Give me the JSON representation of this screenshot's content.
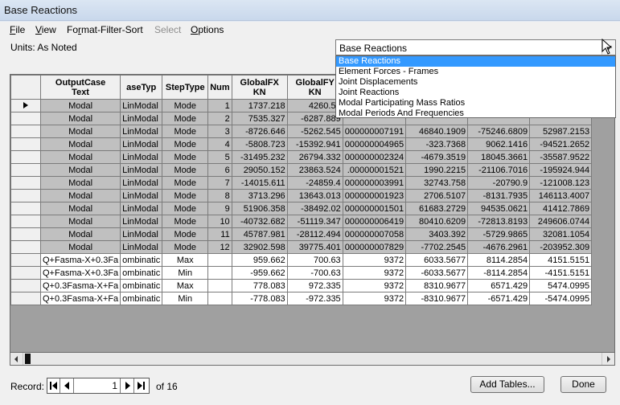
{
  "window": {
    "title": "Base Reactions"
  },
  "menu": [
    {
      "id": "file",
      "label": "File",
      "accel": "F",
      "rest": "ile"
    },
    {
      "id": "view",
      "label": "View",
      "accel": "V",
      "rest": "iew"
    },
    {
      "id": "format",
      "label": "Format-Filter-Sort",
      "pre": "Fo",
      "accel": "r",
      "rest": "mat-Filter-Sort"
    },
    {
      "id": "select",
      "label": "Select",
      "disabled": true
    },
    {
      "id": "options",
      "label": "Options",
      "accel": "O",
      "rest": "ptions"
    }
  ],
  "units_label": "Units:  As Noted",
  "table_selector": {
    "value": "Base Reactions",
    "options": [
      "Base Reactions",
      "Element Forces - Frames",
      "Joint Displacements",
      "Joint Reactions",
      "Modal Participating Mass Ratios",
      "Modal Periods And Frequencies"
    ],
    "selected_index": 0
  },
  "grid": {
    "columns": [
      {
        "id": "outputcase",
        "line1": "OutputCase",
        "line2": "Text"
      },
      {
        "id": "casetype",
        "line1": "aseTyp",
        "line2": ""
      },
      {
        "id": "steptype",
        "line1": "StepType",
        "line2": ""
      },
      {
        "id": "stepnum",
        "line1": "Num",
        "line2": ""
      },
      {
        "id": "globalfx",
        "line1": "GlobalFX",
        "line2": "KN"
      },
      {
        "id": "globalfy",
        "line1": "GlobalFY",
        "line2": "KN"
      },
      {
        "id": "globalfz",
        "line1": "",
        "line2": ""
      },
      {
        "id": "globalmx",
        "line1": "",
        "line2": ""
      },
      {
        "id": "globalmy",
        "line1": "",
        "line2": ""
      },
      {
        "id": "globalmz",
        "line1": "",
        "line2": ""
      }
    ],
    "rows": [
      {
        "current": true,
        "cells": [
          "Modal",
          "LinModal",
          "Mode",
          "1",
          "1737.218",
          "4260.57",
          "",
          "",
          "",
          ""
        ]
      },
      {
        "cells": [
          "Modal",
          "LinModal",
          "Mode",
          "2",
          "7535.327",
          "-6287.889",
          "",
          "",
          "",
          ""
        ]
      },
      {
        "cells": [
          "Modal",
          "LinModal",
          "Mode",
          "3",
          "-8726.646",
          "-5262.545",
          "000000007191",
          "46840.1909",
          "-75246.6809",
          "52987.2153"
        ]
      },
      {
        "cells": [
          "Modal",
          "LinModal",
          "Mode",
          "4",
          "-5808.723",
          "-15392.941",
          "000000004965",
          "-323.7368",
          "9062.1416",
          "-94521.2652"
        ]
      },
      {
        "cells": [
          "Modal",
          "LinModal",
          "Mode",
          "5",
          "-31495.232",
          "26794.332",
          "000000002324",
          "-4679.3519",
          "18045.3661",
          "-35587.9522"
        ]
      },
      {
        "cells": [
          "Modal",
          "LinModal",
          "Mode",
          "6",
          "29050.152",
          "23863.524",
          ".00000001521",
          "1990.2215",
          "-21106.7016",
          "-195924.944"
        ]
      },
      {
        "cells": [
          "Modal",
          "LinModal",
          "Mode",
          "7",
          "-14015.611",
          "-24859.4",
          "000000003991",
          "32743.758",
          "-20790.9",
          "-121008.123"
        ]
      },
      {
        "cells": [
          "Modal",
          "LinModal",
          "Mode",
          "8",
          "3713.296",
          "13643.013",
          "000000001923",
          "2706.5107",
          "-8131.7935",
          "146113.4007"
        ]
      },
      {
        "cells": [
          "Modal",
          "LinModal",
          "Mode",
          "9",
          "51906.358",
          "-38492.02",
          "000000001501",
          "61683.2729",
          "94535.0621",
          "41412.7869"
        ]
      },
      {
        "cells": [
          "Modal",
          "LinModal",
          "Mode",
          "10",
          "-40732.682",
          "-51119.347",
          "000000006419",
          "80410.6209",
          "-72813.8193",
          "249606.0744"
        ]
      },
      {
        "cells": [
          "Modal",
          "LinModal",
          "Mode",
          "11",
          "45787.981",
          "-28112.494",
          "000000007058",
          "3403.392",
          "-5729.9865",
          "32081.1054"
        ]
      },
      {
        "cells": [
          "Modal",
          "LinModal",
          "Mode",
          "12",
          "32902.598",
          "39775.401",
          "000000007829",
          "-7702.2545",
          "-4676.2961",
          "-203952.309"
        ]
      },
      {
        "white": true,
        "cells": [
          "Q+Fasma-X+0.3Fa",
          "ombinatic",
          "Max",
          "",
          "959.662",
          "700.63",
          "9372",
          "6033.5677",
          "8114.2854",
          "4151.5151"
        ]
      },
      {
        "white": true,
        "cells": [
          "Q+Fasma-X+0.3Fa",
          "ombinatic",
          "Min",
          "",
          "-959.662",
          "-700.63",
          "9372",
          "-6033.5677",
          "-8114.2854",
          "-4151.5151"
        ]
      },
      {
        "white": true,
        "cells": [
          "Q+0.3Fasma-X+Fa",
          "ombinatic",
          "Max",
          "",
          "778.083",
          "972.335",
          "9372",
          "8310.9677",
          "6571.429",
          "5474.0995"
        ]
      },
      {
        "white": true,
        "cells": [
          "Q+0.3Fasma-X+Fa",
          "ombinatic",
          "Min",
          "",
          "-778.083",
          "-972.335",
          "9372",
          "-8310.9677",
          "-6571.429",
          "-5474.0995"
        ]
      }
    ]
  },
  "record_nav": {
    "label": "Record:",
    "current": "1",
    "of_label": "of 16"
  },
  "buttons": {
    "add_tables": "Add Tables...",
    "done": "Done"
  }
}
